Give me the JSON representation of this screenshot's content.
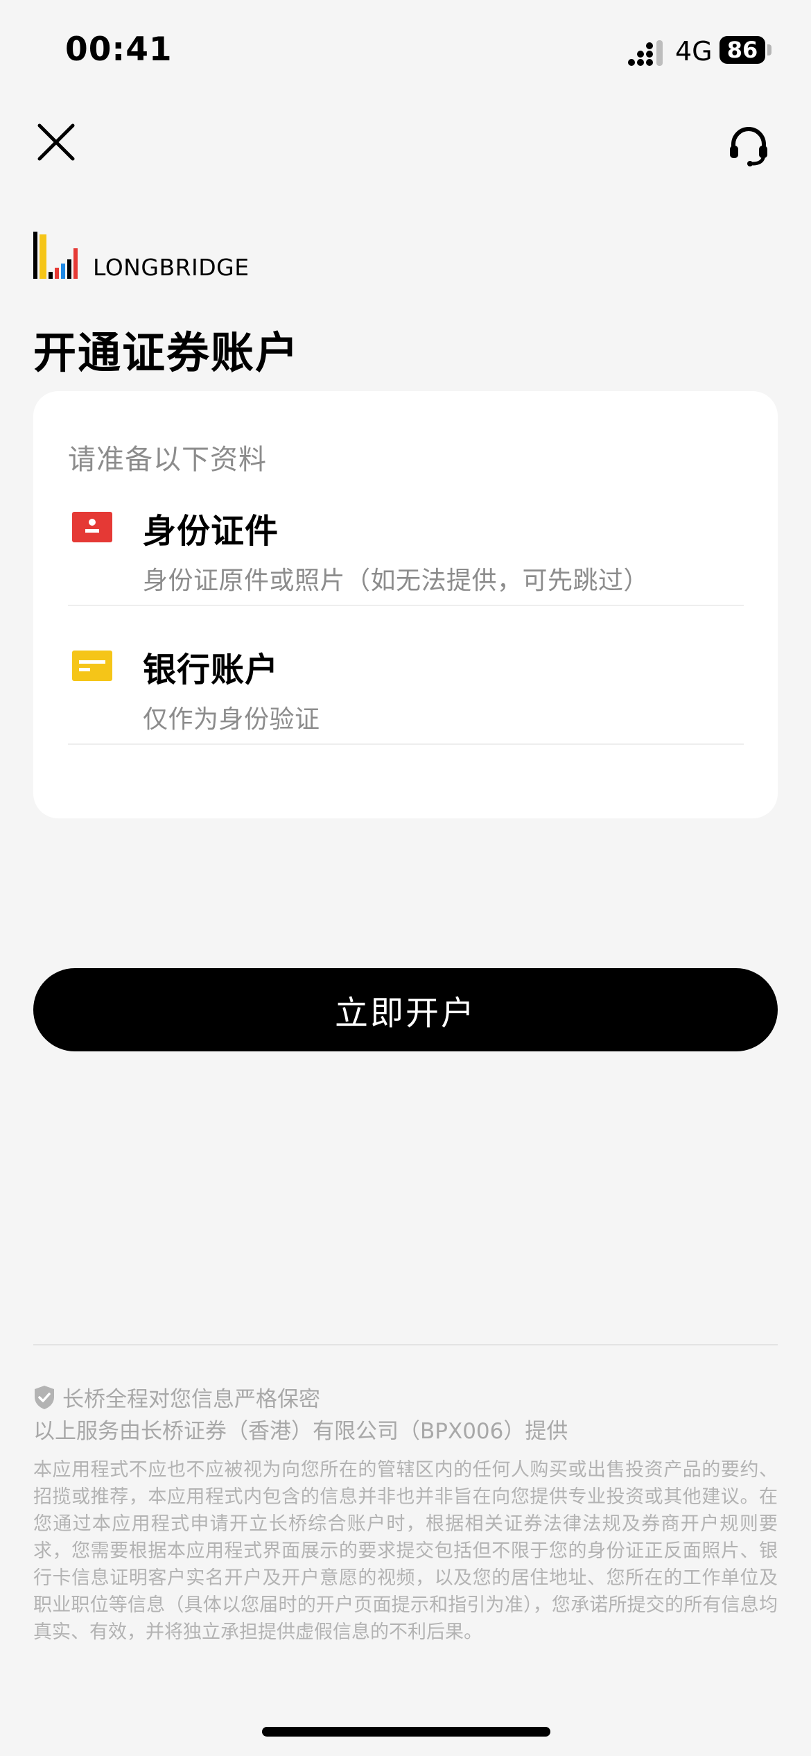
{
  "status_bar": {
    "time": "00:41",
    "network": "4G",
    "battery": "86"
  },
  "header": {
    "close_icon": "close-icon",
    "support_icon": "headset-icon"
  },
  "brand": {
    "logo_text": "LONGBRIDGE",
    "colors": {
      "yellow": "#f5c518",
      "red": "#e53935",
      "blue": "#1e88e5"
    }
  },
  "page": {
    "title": "开通证券账户"
  },
  "card": {
    "subtitle": "请准备以下资料",
    "items": [
      {
        "title": "身份证件",
        "desc": "身份证原件或照片（如无法提供，可先跳过）",
        "icon": "id-card-icon",
        "color": "#e53935"
      },
      {
        "title": "银行账户",
        "desc": "仅作为身份验证",
        "icon": "bank-card-icon",
        "color": "#f5c518"
      }
    ]
  },
  "cta": {
    "label": "立即开户"
  },
  "footer": {
    "privacy": "长桥全程对您信息严格保密",
    "provider": "以上服务由长桥证券（香港）有限公司（BPX006）提供",
    "disclaimer": "本应用程式不应也不应被视为向您所在的管辖区内的任何人购买或出售投资产品的要约、招揽或推荐，本应用程式内包含的信息并非也并非旨在向您提供专业投资或其他建议。在您通过本应用程式申请开立长桥综合账户时，根据相关证券法律法规及券商开户规则要求，您需要根据本应用程式界面展示的要求提交包括但不限于您的身份证正反面照片、银行卡信息证明客户实名开户及开户意愿的视频，以及您的居住地址、您所在的工作单位及职业职位等信息（具体以您届时的开户页面提示和指引为准），您承诺所提交的所有信息均真实、有效，并将独立承担提供虚假信息的不利后果。"
  }
}
